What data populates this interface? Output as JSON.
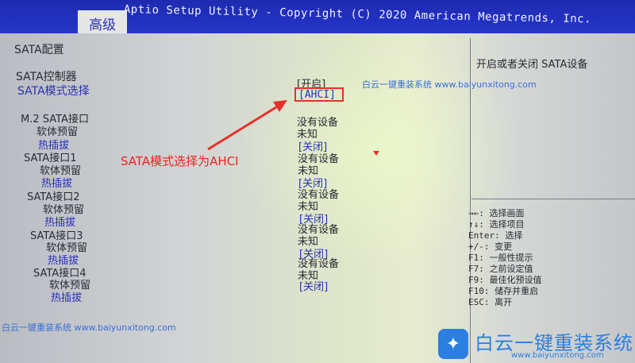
{
  "header": {
    "title": "Aptio Setup Utility - Copyright (C) 2020 American Megatrends, Inc.",
    "tab": "高级"
  },
  "section": {
    "title": "SATA配置"
  },
  "settings": {
    "sata_controller": {
      "label": "SATA控制器",
      "value": "[开启]"
    },
    "sata_mode": {
      "label": "SATA模式选择",
      "value": "[AHCI]"
    }
  },
  "ports": [
    {
      "name": "M.2 SATA接口",
      "device": "没有设备",
      "reserve_label": "软体预留",
      "reserve_value": "未知",
      "hotplug_label": "热插拔",
      "hotplug_value": "[关闭]"
    },
    {
      "name": "SATA接口1",
      "device": "没有设备",
      "reserve_label": "软体预留",
      "reserve_value": "未知",
      "hotplug_label": "热插拔",
      "hotplug_value": "[关闭]"
    },
    {
      "name": "SATA接口2",
      "device": "没有设备",
      "reserve_label": "软体预留",
      "reserve_value": "未知",
      "hotplug_label": "热插拔",
      "hotplug_value": "[关闭]"
    },
    {
      "name": "SATA接口3",
      "device": "没有设备",
      "reserve_label": "软体预留",
      "reserve_value": "未知",
      "hotplug_label": "热插拔",
      "hotplug_value": "[关闭]"
    },
    {
      "name": "SATA接口4",
      "device": "没有设备",
      "reserve_label": "软体预留",
      "reserve_value": "未知",
      "hotplug_label": "热插拔",
      "hotplug_value": "[关闭]"
    }
  ],
  "help": {
    "description": "开启或者关闭 SATA设备",
    "keys": [
      "→←: 选择画面",
      "↑↓: 选择项目",
      "Enter: 选择",
      "+/-: 变更",
      "F1: 一般性提示",
      "F7: 之前设定值",
      "F9: 最佳化预设值",
      "F10: 储存并重启",
      "ESC: 离开"
    ]
  },
  "annotation": {
    "text": "SATA模式选择为AHCI",
    "color": "#e8261d"
  },
  "watermarks": {
    "top": "白云一键重装系统 www.baiyunxitong.com",
    "bottom": "白云一键重装系统 www.baiyunxitong.com",
    "logo_text": "白云一键重装系统",
    "logo_url": "www.baiyunxitong.com"
  },
  "colors": {
    "bios_blue": "#2231c2",
    "panel_grey": "#d2d4d6",
    "highlight_red": "#e8302a",
    "watermark_blue": "#2b7fe0"
  }
}
